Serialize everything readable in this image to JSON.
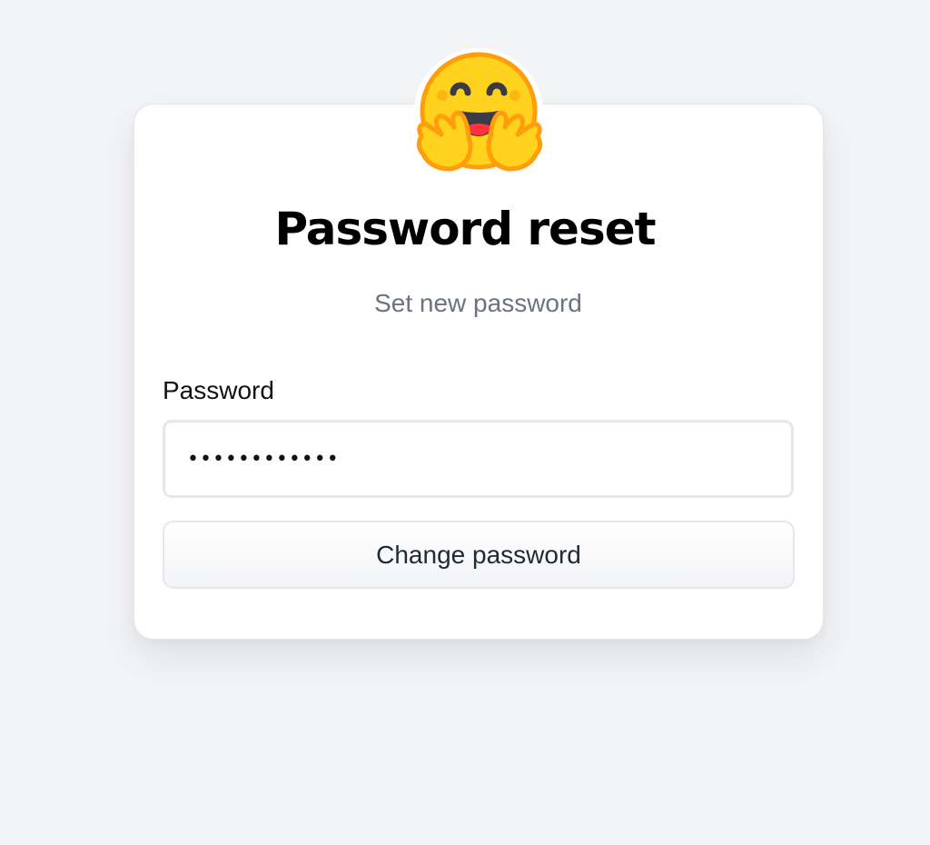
{
  "logo": {
    "icon": "hugging-face-emoji-icon"
  },
  "header": {
    "title": "Password reset",
    "subtitle": "Set new password"
  },
  "form": {
    "password_label": "Password",
    "password_value": "••••••••••••",
    "submit_label": "Change password"
  },
  "colors": {
    "background": "#f3f4f6",
    "card": "#ffffff",
    "subtitle": "#6b7280",
    "logo_face": "#FFD21E",
    "logo_outline": "#FF9D0B"
  }
}
